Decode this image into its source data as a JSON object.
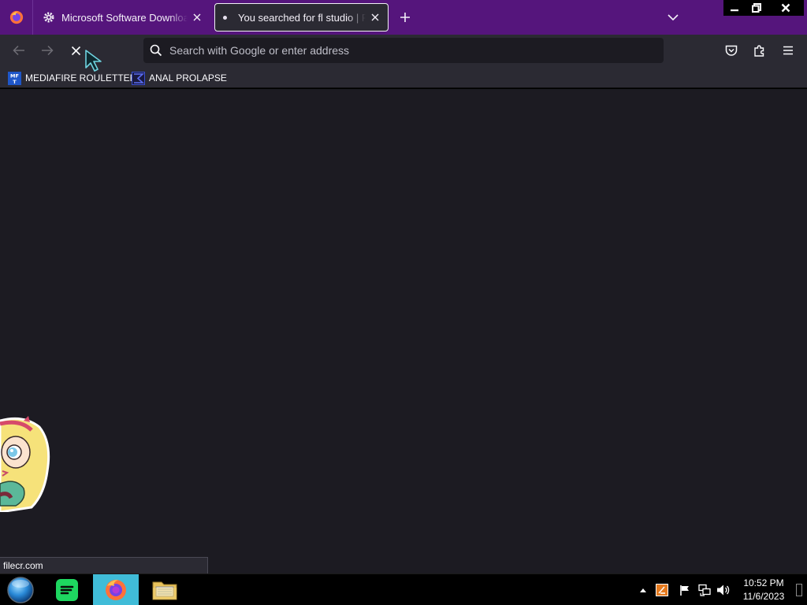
{
  "browser": {
    "tabs": [
      {
        "title": "Microsoft Software Download L",
        "active": false,
        "icon": "gear-icon"
      },
      {
        "title": "You searched for fl studio | FileCR",
        "active": true,
        "loading": true
      }
    ],
    "new_tab_icon": "plus-icon",
    "tab_list_icon": "chevron-down-icon",
    "window_controls": [
      "minimize-icon",
      "restore-icon",
      "close-icon"
    ]
  },
  "navbar": {
    "back_icon": "arrow-left-icon",
    "forward_icon": "arrow-right-icon",
    "stop_icon": "close-icon",
    "url_placeholder": "Search with Google or enter address",
    "url_value": "",
    "right_icons": [
      "pocket-icon",
      "extensions-icon",
      "hamburger-menu-icon"
    ]
  },
  "bookmarks": [
    {
      "label": "MEDIAFIRE ROULETTER",
      "icon": "mediafire-icon"
    },
    {
      "label": "ANAL PROLAPSE",
      "icon": "sigma-icon"
    }
  ],
  "content": {
    "status_url": "filecr.com",
    "background": "#1c1b22"
  },
  "taskbar": {
    "apps": [
      {
        "name": "Spotify",
        "icon": "spotify-icon"
      },
      {
        "name": "Firefox",
        "icon": "firefox-icon",
        "active": true
      },
      {
        "name": "File Explorer",
        "icon": "folder-icon"
      }
    ],
    "tray_icons": [
      "show-hidden-icons",
      "tray-app-icon",
      "flag-icon",
      "network-icon",
      "volume-icon"
    ],
    "clock": {
      "time": "10:52 PM",
      "date": "11/6/2023"
    }
  },
  "colors": {
    "tabstrip": "#55157c",
    "toolbar": "#2b2a33",
    "content": "#1c1b22",
    "taskbar_active": "#40bcd8"
  }
}
